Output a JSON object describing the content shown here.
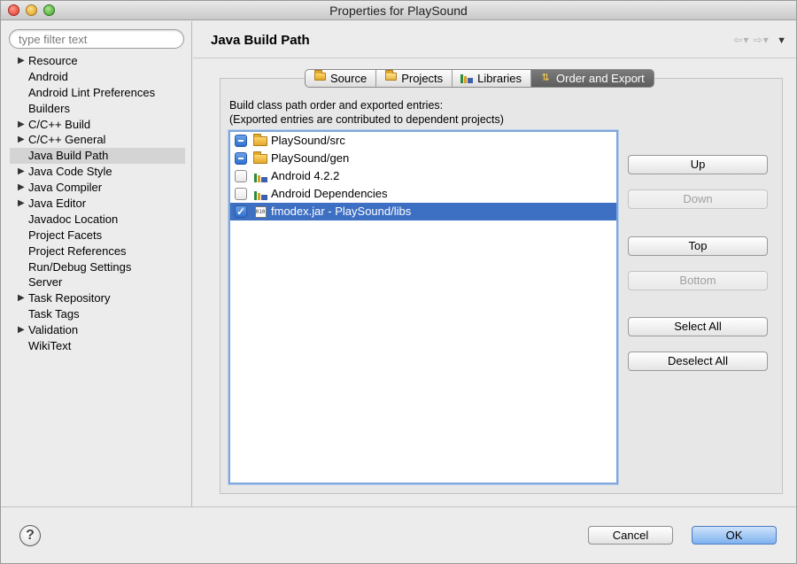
{
  "window": {
    "title": "Properties for PlaySound"
  },
  "filter": {
    "placeholder": "type filter text"
  },
  "tree": [
    {
      "label": "Resource",
      "expandable": true
    },
    {
      "label": "Android",
      "expandable": false
    },
    {
      "label": "Android Lint Preferences",
      "expandable": false
    },
    {
      "label": "Builders",
      "expandable": false
    },
    {
      "label": "C/C++ Build",
      "expandable": true
    },
    {
      "label": "C/C++ General",
      "expandable": true
    },
    {
      "label": "Java Build Path",
      "expandable": false,
      "selected": true
    },
    {
      "label": "Java Code Style",
      "expandable": true
    },
    {
      "label": "Java Compiler",
      "expandable": true
    },
    {
      "label": "Java Editor",
      "expandable": true
    },
    {
      "label": "Javadoc Location",
      "expandable": false
    },
    {
      "label": "Project Facets",
      "expandable": false
    },
    {
      "label": "Project References",
      "expandable": false
    },
    {
      "label": "Run/Debug Settings",
      "expandable": false
    },
    {
      "label": "Server",
      "expandable": false
    },
    {
      "label": "Task Repository",
      "expandable": true
    },
    {
      "label": "Task Tags",
      "expandable": false
    },
    {
      "label": "Validation",
      "expandable": true
    },
    {
      "label": "WikiText",
      "expandable": false
    }
  ],
  "page": {
    "title": "Java Build Path"
  },
  "tabs": [
    {
      "label": "Source",
      "icon": "source-folder-icon"
    },
    {
      "label": "Projects",
      "icon": "projects-folder-icon"
    },
    {
      "label": "Libraries",
      "icon": "libraries-icon"
    },
    {
      "label": "Order and Export",
      "icon": "order-export-icon",
      "active": true
    }
  ],
  "description": {
    "line1": "Build class path order and exported entries:",
    "line2": "(Exported entries are contributed to dependent projects)"
  },
  "entries": [
    {
      "label": "PlaySound/src",
      "state": "mixed",
      "icon": "source-folder-icon"
    },
    {
      "label": "PlaySound/gen",
      "state": "mixed",
      "icon": "source-folder-icon"
    },
    {
      "label": "Android 4.2.2",
      "state": "unchecked",
      "icon": "library-icon"
    },
    {
      "label": "Android Dependencies",
      "state": "unchecked",
      "icon": "library-icon"
    },
    {
      "label": "fmodex.jar - PlaySound/libs",
      "state": "checked",
      "icon": "jar-icon",
      "selected": true
    }
  ],
  "buttons": {
    "up": "Up",
    "down": "Down",
    "top": "Top",
    "bottom": "Bottom",
    "select_all": "Select All",
    "deselect_all": "Deselect All"
  },
  "dialog": {
    "cancel": "Cancel",
    "ok": "OK",
    "help": "?"
  }
}
